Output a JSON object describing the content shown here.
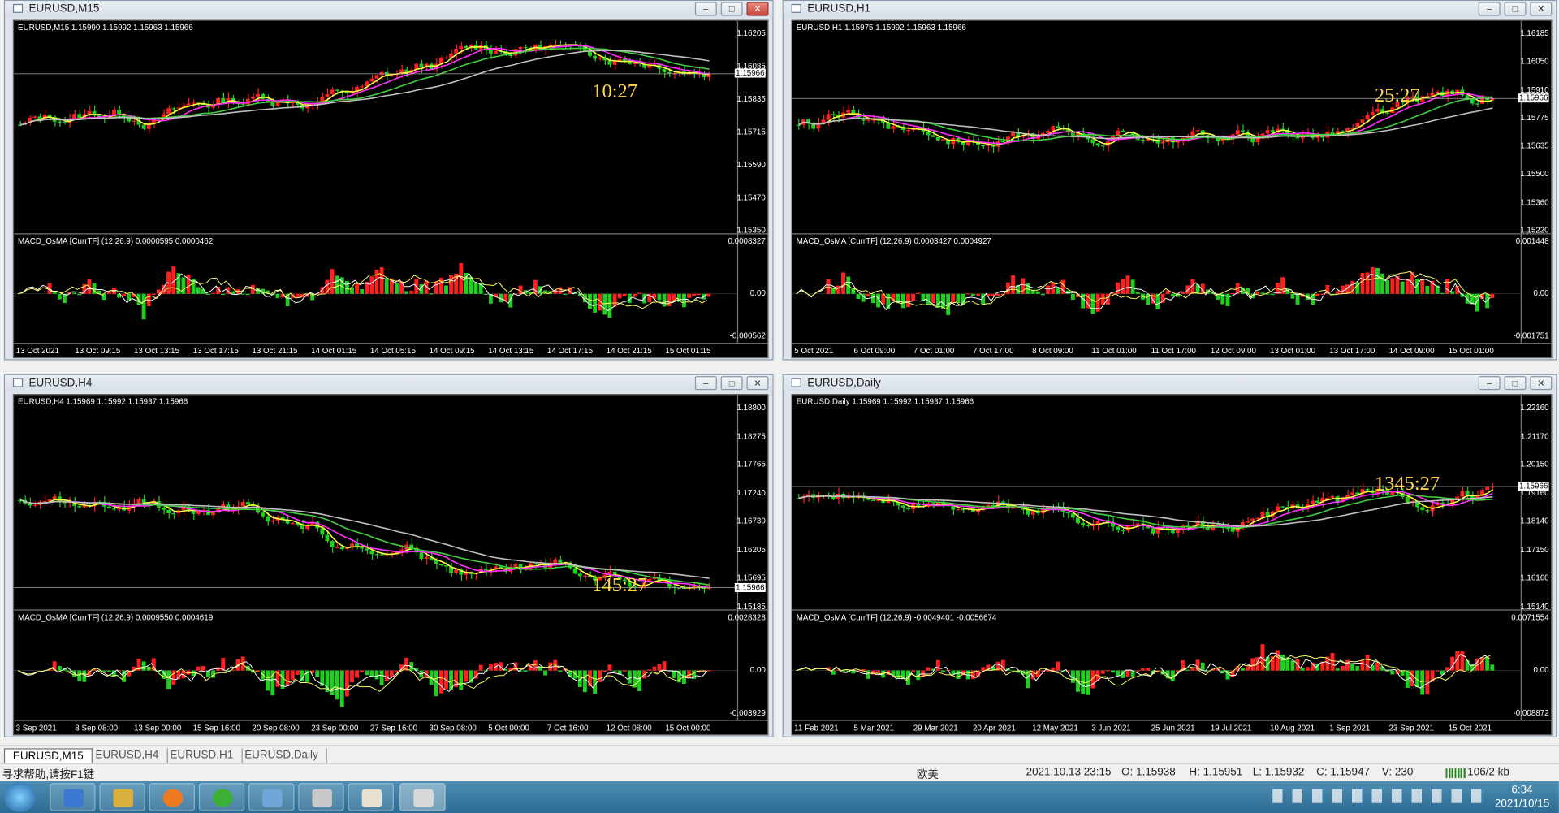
{
  "windows": [
    {
      "title": "EURUSD,M15",
      "header": "EURUSD,M15  1.15990 1.15992 1.15963 1.15966",
      "macd": "MACD_OsMA [CurrTF] (12,26,9) 0.0000595 0.0000462",
      "timer": "10:27",
      "cur_price": "1.15966",
      "prices": [
        "1.16205",
        "1.16085",
        "1.15835",
        "1.15715",
        "1.15590",
        "1.15470",
        "1.15350"
      ],
      "macd_scale": [
        "0.0008327",
        "0.00",
        "-0.000562"
      ],
      "x_labels": [
        "13 Oct 2021",
        "13 Oct 09:15",
        "13 Oct 13:15",
        "13 Oct 17:15",
        "13 Oct 21:15",
        "14 Oct 01:15",
        "14 Oct 05:15",
        "14 Oct 09:15",
        "14 Oct 13:15",
        "14 Oct 17:15",
        "14 Oct 21:15",
        "15 Oct 01:15"
      ]
    },
    {
      "title": "EURUSD,H1",
      "header": "EURUSD,H1  1.15975 1.15992 1.15963 1.15966",
      "macd": "MACD_OsMA [CurrTF] (12,26,9) 0.0003427 0.0004927",
      "timer": "25:27",
      "cur_price": "1.15966",
      "prices": [
        "1.16185",
        "1.16050",
        "1.15910",
        "1.15775",
        "1.15635",
        "1.15500",
        "1.15360",
        "1.15220"
      ],
      "macd_scale": [
        "0.001448",
        "0.00",
        "-0.001751"
      ],
      "x_labels": [
        "5 Oct 2021",
        "6 Oct 09:00",
        "7 Oct 01:00",
        "7 Oct 17:00",
        "8 Oct 09:00",
        "11 Oct 01:00",
        "11 Oct 17:00",
        "12 Oct 09:00",
        "13 Oct 01:00",
        "13 Oct 17:00",
        "14 Oct 09:00",
        "15 Oct 01:00"
      ]
    },
    {
      "title": "EURUSD,H4",
      "header": "EURUSD,H4  1.15969 1.15992 1.15937 1.15966",
      "macd": "MACD_OsMA [CurrTF] (12,26,9) 0.0009550 0.0004619",
      "timer": "145:27",
      "cur_price": "1.15966",
      "prices": [
        "1.18800",
        "1.18275",
        "1.17765",
        "1.17240",
        "1.16730",
        "1.16205",
        "1.15695",
        "1.15185"
      ],
      "macd_scale": [
        "0.0028328",
        "0.00",
        "-0.003929"
      ],
      "x_labels": [
        "3 Sep 2021",
        "8 Sep 08:00",
        "13 Sep 00:00",
        "15 Sep 16:00",
        "20 Sep 08:00",
        "23 Sep 00:00",
        "27 Sep 16:00",
        "30 Sep 08:00",
        "5 Oct 00:00",
        "7 Oct 16:00",
        "12 Oct 08:00",
        "15 Oct 00:00"
      ]
    },
    {
      "title": "EURUSD,Daily",
      "header": "EURUSD,Daily  1.15969 1.15992 1.15937 1.15966",
      "macd": "MACD_OsMA [CurrTF] (12,26,9) -0.0049401 -0.0056674",
      "timer": "1345:27",
      "cur_price": "1.15966",
      "prices": [
        "1.22160",
        "1.21170",
        "1.20150",
        "1.19160",
        "1.18140",
        "1.17150",
        "1.16160",
        "1.15140"
      ],
      "macd_scale": [
        "0.0071554",
        "0.00",
        "-0.008872"
      ],
      "x_labels": [
        "11 Feb 2021",
        "5 Mar 2021",
        "29 Mar 2021",
        "20 Apr 2021",
        "12 May 2021",
        "3 Jun 2021",
        "25 Jun 2021",
        "19 Jul 2021",
        "10 Aug 2021",
        "1 Sep 2021",
        "23 Sep 2021",
        "15 Oct 2021"
      ]
    }
  ],
  "tabs": [
    "EURUSD,M15",
    "EURUSD,H4",
    "EURUSD,H1",
    "EURUSD,Daily"
  ],
  "status": {
    "help": "寻求帮助,请按F1键",
    "profile": "欧美",
    "datetime": "2021.10.13 23:15",
    "open": "O: 1.15938",
    "high": "H: 1.15951",
    "low": "L: 1.15932",
    "close": "C: 1.15947",
    "volume": "V: 230",
    "traffic": "106/2 kb"
  },
  "clock": {
    "time": "6:34",
    "date": "2021/10/15"
  },
  "colors": {
    "bull": "#ff2020",
    "bear": "#20d020",
    "ma_fast": "#ffff40",
    "ma_mid": "#ff30ff",
    "ma_slow": "#40d040",
    "ma_long": "#c0c0c0",
    "timer": "#ffd84a"
  }
}
